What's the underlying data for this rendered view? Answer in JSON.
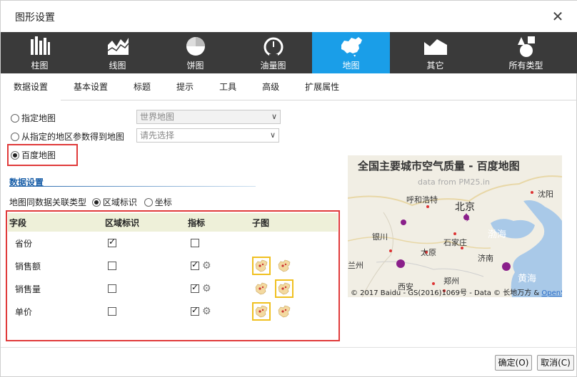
{
  "dialog": {
    "title": "图形设置"
  },
  "chart_types": [
    {
      "label": "柱图",
      "icon": "bar-chart-icon"
    },
    {
      "label": "线图",
      "icon": "area-chart-icon"
    },
    {
      "label": "饼图",
      "icon": "pie-chart-icon"
    },
    {
      "label": "油量图",
      "icon": "gauge-icon"
    },
    {
      "label": "地图",
      "icon": "china-map-icon",
      "active": true
    },
    {
      "label": "其它",
      "icon": "mountain-icon"
    },
    {
      "label": "所有类型",
      "icon": "shapes-icon"
    }
  ],
  "tabs": [
    "数据设置",
    "基本设置",
    "标题",
    "提示",
    "工具",
    "高级",
    "扩展属性"
  ],
  "active_tab": "数据设置",
  "map_source": {
    "option1": {
      "label": "指定地图",
      "value": "世界地图"
    },
    "option2": {
      "label": "从指定的地区参数得到地图",
      "placeholder": "请先选择"
    },
    "option3": {
      "label": "百度地图",
      "selected": true
    }
  },
  "data_settings": {
    "section_title": "数据设置",
    "assoc_label": "地图同数据关联类型",
    "assoc_options": [
      "区域标识",
      "坐标"
    ],
    "assoc_selected": "区域标识"
  },
  "grid": {
    "headers": [
      "字段",
      "区域标识",
      "指标",
      "子图"
    ],
    "rows": [
      {
        "field": "省份",
        "region": true,
        "metric": false,
        "gear": false,
        "thumbs": []
      },
      {
        "field": "销售额",
        "region": false,
        "metric": true,
        "gear": true,
        "thumbs": [
          true,
          false
        ]
      },
      {
        "field": "销售量",
        "region": false,
        "metric": true,
        "gear": true,
        "thumbs": [
          false,
          true
        ]
      },
      {
        "field": "单价",
        "region": false,
        "metric": true,
        "gear": true,
        "thumbs": [
          true,
          false
        ]
      }
    ]
  },
  "preview": {
    "title": "全国主要城市空气质量 - 百度地图",
    "subtitle": "data from PM25.in",
    "cities": {
      "huhehaote": "呼和浩特",
      "beijing": "北京",
      "shenyang": "沈阳",
      "yinchuan": "银川",
      "shijiazhuang": "石家庄",
      "taiyuan": "太原",
      "jinan": "济南",
      "lanzhou": "兰州",
      "zhengzhou": "郑州",
      "xian": "西安",
      "bohai": "渤海",
      "huanghai": "黄海"
    },
    "credit": "© 2017 Baidu - GS(2016)1069号 - Data © 长地万方 &",
    "credit_link": "OpenS"
  },
  "buttons": {
    "ok": "确定(O)",
    "cancel": "取消(C)"
  }
}
